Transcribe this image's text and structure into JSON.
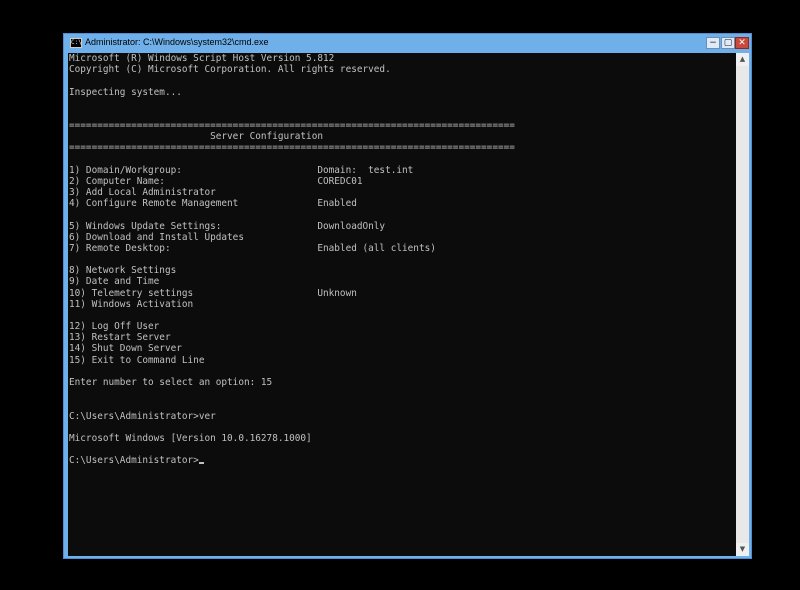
{
  "window": {
    "title": "Administrator: C:\\Windows\\system32\\cmd.exe",
    "icon_text": "C:\\",
    "controls": {
      "minimize": "−",
      "maximize": "▢",
      "close": "✕"
    }
  },
  "console": {
    "lines": [
      "Microsoft (R) Windows Script Host Version 5.812",
      "Copyright (C) Microsoft Corporation. All rights reserved.",
      "",
      "Inspecting system...",
      "",
      "",
      "===============================================================================",
      "                         Server Configuration",
      "===============================================================================",
      "",
      "1) Domain/Workgroup:                        Domain:  test.int",
      "2) Computer Name:                           COREDC01",
      "3) Add Local Administrator",
      "4) Configure Remote Management              Enabled",
      "",
      "5) Windows Update Settings:                 DownloadOnly",
      "6) Download and Install Updates",
      "7) Remote Desktop:                          Enabled (all clients)",
      "",
      "8) Network Settings",
      "9) Date and Time",
      "10) Telemetry settings                      Unknown",
      "11) Windows Activation",
      "",
      "12) Log Off User",
      "13) Restart Server",
      "14) Shut Down Server",
      "15) Exit to Command Line",
      "",
      "Enter number to select an option: 15",
      "",
      "",
      "C:\\Users\\Administrator>ver",
      "",
      "Microsoft Windows [Version 10.0.16278.1000]",
      "",
      "C:\\Users\\Administrator>"
    ]
  },
  "scrollbar": {
    "up_arrow": "▲",
    "down_arrow": "▼"
  }
}
